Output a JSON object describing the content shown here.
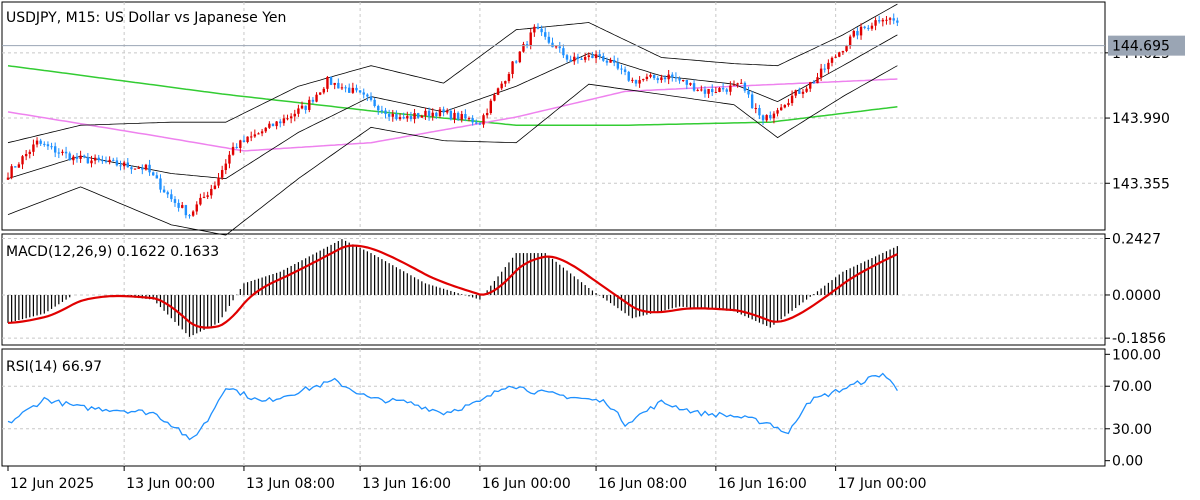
{
  "chart_data": [
    {
      "type": "candlestick",
      "title": "USDJPY, M15:  US Dollar vs Japanese Yen",
      "symbol": "USDJPY",
      "timeframe": "M15",
      "description": "US Dollar vs Japanese Yen",
      "ylim": [
        142.9,
        145.12
      ],
      "yticks": [
        "143.355",
        "143.990",
        "144.625"
      ],
      "ytick_values": [
        143.355,
        143.99,
        144.625
      ],
      "last_price": "144.695",
      "last_price_value": 144.695,
      "grid": true,
      "colors": {
        "bull": "#e00000",
        "bear": "#1e90ff",
        "bb": "#000000",
        "ma_slow": "#33cc33",
        "ma_fast": "#ee82ee",
        "price_line": "#9aa5b4",
        "price_tag_bg": "#9aa5b4"
      },
      "price_anchors": [
        [
          0,
          143.45
        ],
        [
          8,
          143.75
        ],
        [
          18,
          143.6
        ],
        [
          28,
          143.55
        ],
        [
          38,
          143.5
        ],
        [
          45,
          143.2
        ],
        [
          50,
          143.05
        ],
        [
          57,
          143.35
        ],
        [
          62,
          143.7
        ],
        [
          72,
          143.9
        ],
        [
          82,
          144.1
        ],
        [
          88,
          144.35
        ],
        [
          95,
          144.25
        ],
        [
          108,
          143.98
        ],
        [
          118,
          144.05
        ],
        [
          130,
          143.95
        ],
        [
          138,
          144.45
        ],
        [
          145,
          144.85
        ],
        [
          155,
          144.55
        ],
        [
          163,
          144.6
        ],
        [
          172,
          144.35
        ],
        [
          182,
          144.4
        ],
        [
          192,
          144.25
        ],
        [
          202,
          144.3
        ],
        [
          208,
          143.95
        ],
        [
          212,
          144.1
        ],
        [
          222,
          144.35
        ],
        [
          233,
          144.8
        ],
        [
          241,
          144.98
        ],
        [
          245,
          144.92
        ]
      ],
      "bb_mid_anchors": [
        [
          0,
          143.4
        ],
        [
          20,
          143.62
        ],
        [
          45,
          143.45
        ],
        [
          60,
          143.4
        ],
        [
          80,
          143.85
        ],
        [
          100,
          144.2
        ],
        [
          120,
          144.05
        ],
        [
          140,
          144.3
        ],
        [
          160,
          144.62
        ],
        [
          180,
          144.4
        ],
        [
          200,
          144.32
        ],
        [
          212,
          144.15
        ],
        [
          230,
          144.5
        ],
        [
          245,
          144.8
        ]
      ],
      "bb_width_anchors": [
        [
          0,
          0.35
        ],
        [
          20,
          0.3
        ],
        [
          45,
          0.5
        ],
        [
          60,
          0.55
        ],
        [
          80,
          0.45
        ],
        [
          100,
          0.3
        ],
        [
          120,
          0.28
        ],
        [
          140,
          0.55
        ],
        [
          160,
          0.3
        ],
        [
          180,
          0.18
        ],
        [
          200,
          0.2
        ],
        [
          212,
          0.35
        ],
        [
          230,
          0.3
        ],
        [
          245,
          0.3
        ]
      ],
      "ma_slow_anchors": [
        [
          0,
          144.5
        ],
        [
          60,
          144.22
        ],
        [
          100,
          144.06
        ],
        [
          140,
          143.92
        ],
        [
          170,
          143.92
        ],
        [
          210,
          143.95
        ],
        [
          245,
          144.1
        ]
      ],
      "ma_fast_anchors": [
        [
          0,
          144.05
        ],
        [
          40,
          143.82
        ],
        [
          65,
          143.67
        ],
        [
          100,
          143.75
        ],
        [
          140,
          144.0
        ],
        [
          170,
          144.25
        ],
        [
          200,
          144.3
        ],
        [
          245,
          144.37
        ]
      ],
      "bar_count": 246
    },
    {
      "type": "bar",
      "title": "MACD(12,26,9) 0.1622 0.1633",
      "indicator": "MACD(12,26,9)",
      "main_value": "0.1622",
      "signal_value": "0.1633",
      "ylim": [
        -0.215,
        0.262
      ],
      "yticks": [
        "0.2427",
        "0.0000",
        "-0.1856"
      ],
      "ytick_values": [
        0.2427,
        0.0,
        -0.1856
      ],
      "colors": {
        "histogram": "#000000",
        "signal": "#e00000"
      },
      "macd_anchors": [
        [
          0,
          -0.12
        ],
        [
          10,
          -0.08
        ],
        [
          18,
          0.0
        ],
        [
          28,
          0.0
        ],
        [
          40,
          -0.02
        ],
        [
          50,
          -0.18
        ],
        [
          58,
          -0.12
        ],
        [
          65,
          0.05
        ],
        [
          75,
          0.1
        ],
        [
          92,
          0.24
        ],
        [
          100,
          0.18
        ],
        [
          115,
          0.05
        ],
        [
          130,
          -0.02
        ],
        [
          140,
          0.18
        ],
        [
          148,
          0.18
        ],
        [
          160,
          0.03
        ],
        [
          172,
          -0.1
        ],
        [
          185,
          -0.05
        ],
        [
          200,
          -0.07
        ],
        [
          210,
          -0.14
        ],
        [
          230,
          0.1
        ],
        [
          245,
          0.21
        ]
      ]
    },
    {
      "type": "line",
      "title": "RSI(14) 66.97",
      "indicator": "RSI(14)",
      "value": "66.97",
      "ylim": [
        -5,
        105
      ],
      "yticks": [
        "100.00",
        "70.00",
        "30.00",
        "0.00"
      ],
      "ytick_values": [
        100,
        70,
        30,
        0
      ],
      "colors": {
        "line": "#1e90ff"
      },
      "rsi_anchors": [
        [
          0,
          35
        ],
        [
          10,
          58
        ],
        [
          20,
          50
        ],
        [
          30,
          48
        ],
        [
          40,
          45
        ],
        [
          47,
          30
        ],
        [
          50,
          18
        ],
        [
          55,
          38
        ],
        [
          60,
          70
        ],
        [
          70,
          55
        ],
        [
          80,
          65
        ],
        [
          90,
          75
        ],
        [
          100,
          58
        ],
        [
          110,
          55
        ],
        [
          120,
          45
        ],
        [
          130,
          55
        ],
        [
          138,
          72
        ],
        [
          145,
          65
        ],
        [
          155,
          60
        ],
        [
          165,
          55
        ],
        [
          170,
          35
        ],
        [
          180,
          55
        ],
        [
          190,
          45
        ],
        [
          200,
          42
        ],
        [
          210,
          35
        ],
        [
          215,
          25
        ],
        [
          220,
          55
        ],
        [
          232,
          70
        ],
        [
          241,
          82
        ],
        [
          245,
          67
        ]
      ]
    }
  ],
  "time_axis": {
    "labels": [
      "12 Jun 2025",
      "13 Jun 00:00",
      "13 Jun 08:00",
      "13 Jun 16:00",
      "16 Jun 00:00",
      "16 Jun 08:00",
      "16 Jun 16:00",
      "17 Jun 00:00"
    ],
    "label_bar_index": [
      0,
      32,
      65,
      97,
      130,
      162,
      195,
      228
    ]
  }
}
